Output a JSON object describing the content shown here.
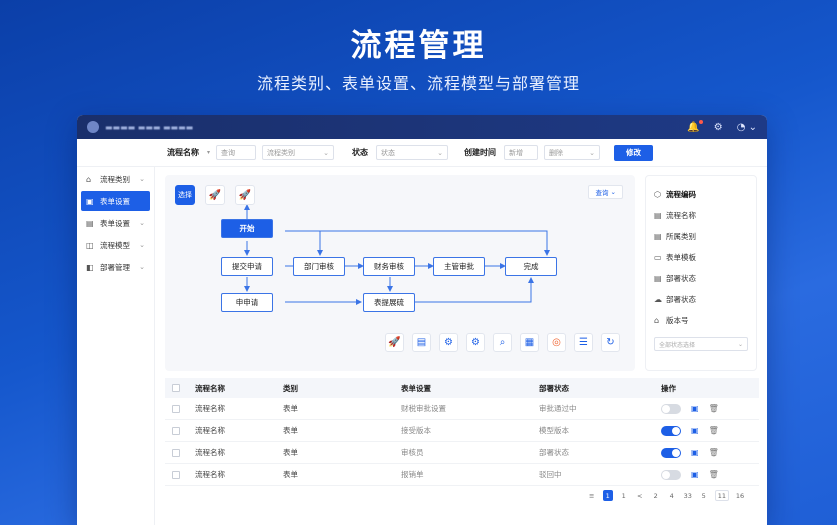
{
  "hero": {
    "title": "流程管理",
    "subtitle": "流程类别、表单设置、流程模型与部署管理"
  },
  "colors": {
    "accent": "#1d5fe6",
    "titlebar": "#1a2f6b",
    "danger": "#ff5a4a",
    "orange": "#f0622d"
  },
  "window": {
    "title_icons": [
      "bell-icon",
      "settings-icon",
      "wifi-icon"
    ]
  },
  "filters": {
    "name_label": "流程名称",
    "name_placeholder": "查询",
    "category_value": "流程类别",
    "status_label": "状态",
    "status_value": "状态",
    "time_label": "创建时间",
    "time_start": "新增",
    "time_end": "删除",
    "submit": "修改"
  },
  "sidebar": {
    "items": [
      {
        "label": "流程类别",
        "icon": "home-icon",
        "active": false
      },
      {
        "label": "表单设置",
        "icon": "form-icon",
        "active": true
      },
      {
        "label": "表单设置",
        "icon": "doc-icon",
        "active": false
      },
      {
        "label": "流程模型",
        "icon": "model-icon",
        "active": false
      },
      {
        "label": "部署管理",
        "icon": "deploy-icon",
        "active": false
      }
    ]
  },
  "canvas": {
    "select_value": "查询",
    "tool_selected_label": "选择",
    "nodes": {
      "start": "开始",
      "submit": "提交申请",
      "dept": "部门审核",
      "finance": "财务审核",
      "manager": "主管审批",
      "done": "完成",
      "reapply": "申申请",
      "form": "表提展硫"
    },
    "bottom_tools": [
      "rocket-icon",
      "doc-icon",
      "gear-icon",
      "gear-icon",
      "search-icon",
      "printer-icon",
      "target-icon",
      "list-icon",
      "refresh-icon"
    ]
  },
  "props": {
    "items": [
      {
        "label": "流程编码",
        "icon": "shield-icon"
      },
      {
        "label": "流程名称",
        "icon": "doc-icon"
      },
      {
        "label": "所属类别",
        "icon": "doc-icon"
      },
      {
        "label": "表单模板",
        "icon": "doc-icon"
      },
      {
        "label": "部署状态",
        "icon": "doc-icon"
      },
      {
        "label": "部署状态",
        "icon": "cloud-icon"
      },
      {
        "label": "版本号",
        "icon": "tag-icon"
      }
    ],
    "select_placeholder": "全部状态选择"
  },
  "table": {
    "headers": [
      "流程名称",
      "类别",
      "表单设置",
      "部署状态",
      "操作"
    ],
    "rows": [
      {
        "name": "流程名称",
        "category": "表单",
        "form": "财税审批设置",
        "status": "审批通过中",
        "enabled": false
      },
      {
        "name": "流程名称",
        "category": "表单",
        "form": "接受版本",
        "status": "模型版本",
        "enabled": true
      },
      {
        "name": "流程名称",
        "category": "表单",
        "form": "审核员",
        "status": "部署状态",
        "enabled": true
      },
      {
        "name": "流程名称",
        "category": "表单",
        "form": "报销单",
        "status": "驳回中",
        "enabled": false
      }
    ]
  },
  "pager": {
    "items": [
      "≡",
      "1",
      "1",
      "<",
      "2",
      "4",
      "33",
      "5",
      "11",
      "16"
    ],
    "current_index": 1
  }
}
